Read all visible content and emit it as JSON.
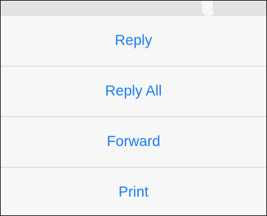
{
  "action_sheet": {
    "items": [
      {
        "label": "Reply"
      },
      {
        "label": "Reply All"
      },
      {
        "label": "Forward"
      },
      {
        "label": "Print"
      }
    ],
    "accent_color": "#1a7cf2"
  }
}
